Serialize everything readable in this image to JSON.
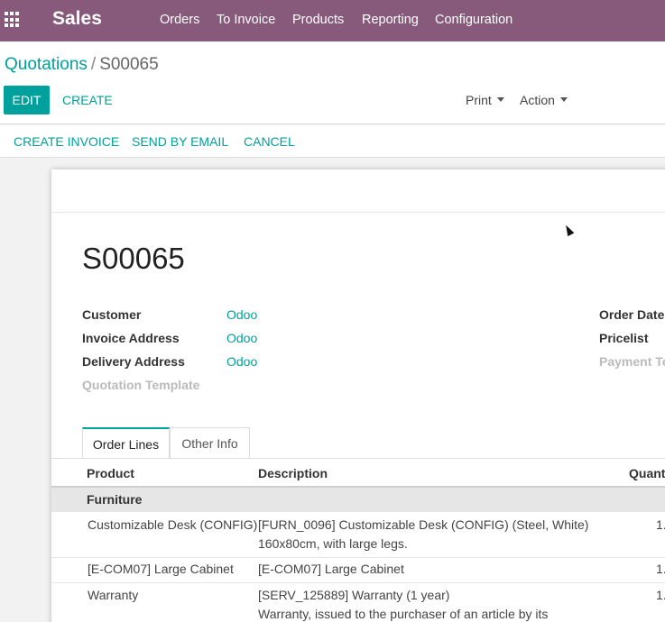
{
  "navbar": {
    "brand": "Sales",
    "menu": [
      "Orders",
      "To Invoice",
      "Products",
      "Reporting",
      "Configuration"
    ]
  },
  "breadcrumb": {
    "parent": "Quotations",
    "separator": "/",
    "current": "S00065"
  },
  "control": {
    "edit_label": "EDIT",
    "create_label": "CREATE",
    "print_label": "Print",
    "action_label": "Action"
  },
  "statusbar": {
    "create_invoice": "CREATE INVOICE",
    "send_by_email": "SEND BY EMAIL",
    "cancel": "CANCEL"
  },
  "record": {
    "name": "S00065",
    "fields_left": [
      {
        "label": "Customer",
        "value": "Odoo"
      },
      {
        "label": "Invoice Address",
        "value": "Odoo"
      },
      {
        "label": "Delivery Address",
        "value": "Odoo"
      },
      {
        "label": "Quotation Template",
        "value": ""
      }
    ],
    "fields_right": [
      {
        "label": "Order Date"
      },
      {
        "label": "Pricelist"
      },
      {
        "label": "Payment Te"
      }
    ]
  },
  "tabs": [
    "Order Lines",
    "Other Info"
  ],
  "table": {
    "headers": [
      "Product",
      "Description",
      "Quanti"
    ],
    "section": "Furniture",
    "rows": [
      {
        "product": "Customizable Desk (CONFIG)",
        "desc1": "[FURN_0096] Customizable Desk (CONFIG) (Steel, White)",
        "desc2": "160x80cm, with large legs.",
        "qty": "1."
      },
      {
        "product": "[E-COM07] Large Cabinet",
        "desc1": "[E-COM07] Large Cabinet",
        "desc2": "",
        "qty": "1."
      },
      {
        "product": "Warranty",
        "desc1": "[SERV_125889] Warranty (1 year)",
        "desc2": "Warranty, issued to the purchaser of an article by its",
        "qty": "1."
      }
    ]
  },
  "colors": {
    "brand": "#875a7b",
    "accent": "#00a09d"
  }
}
